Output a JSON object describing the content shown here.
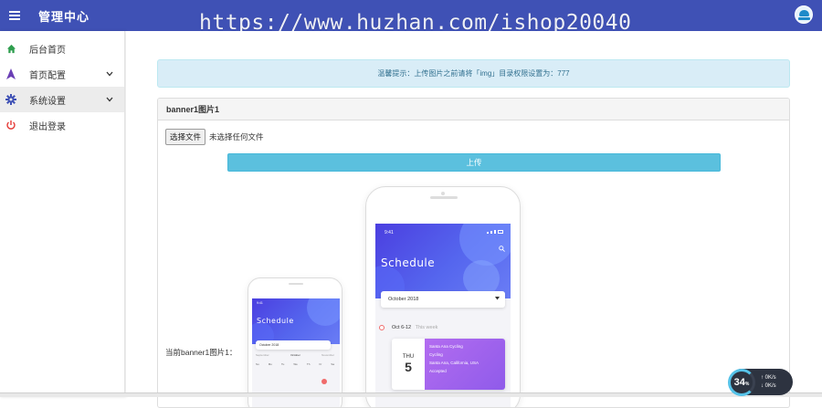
{
  "header": {
    "menu_icon": "hamburger-icon",
    "title": "管理中心",
    "watermark": "https://www.huzhan.com/ishop20040",
    "avatar_icon": "user-avatar-icon",
    "bg_color": "#3f51b5"
  },
  "sidebar": {
    "items": [
      {
        "label": "后台首页",
        "icon": "home-icon",
        "icon_color": "#2e9e4e"
      },
      {
        "label": "首页配置",
        "icon": "triangle-icon",
        "icon_color": "#6a3fb5",
        "chevron": "chevron-down-icon"
      },
      {
        "label": "系统设置",
        "icon": "gear-icon",
        "icon_color": "#3f51b5",
        "chevron": "chevron-down-icon",
        "active": true
      },
      {
        "label": "退出登录",
        "icon": "power-icon",
        "icon_color": "#e53935"
      }
    ]
  },
  "main": {
    "alert": "温馨提示：上传图片之前请将「img」目录权限设置为：777",
    "panel_title": "banner1图片1",
    "file_button": "选择文件",
    "file_status": "未选择任何文件",
    "upload_button": "上传",
    "current_label": "当前banner1图片1：",
    "accent_color": "#5bc0de"
  },
  "preview": {
    "large": {
      "time": "9:41",
      "title": "Schedule",
      "month": "October 2018",
      "week_range": "Oct 6-12",
      "week_note": "This week",
      "event_day": "THU",
      "event_date": "5",
      "event_title": "Santa Ana Cycling",
      "event_type": "Cycling",
      "event_location": "Santa Ana, California, USA",
      "event_status": "Accepted"
    },
    "small": {
      "time": "9:41",
      "title": "Schedule",
      "month": "October 2018",
      "nav_prev": "September",
      "nav_current": "October",
      "nav_next": "November",
      "weekdays": [
        "Su",
        "Mo",
        "Tu",
        "We",
        "Th",
        "Fr",
        "Sa"
      ]
    }
  },
  "perf_widget": {
    "percent": "34",
    "unit": "%",
    "up": "0K/s",
    "down": "0K/s"
  }
}
